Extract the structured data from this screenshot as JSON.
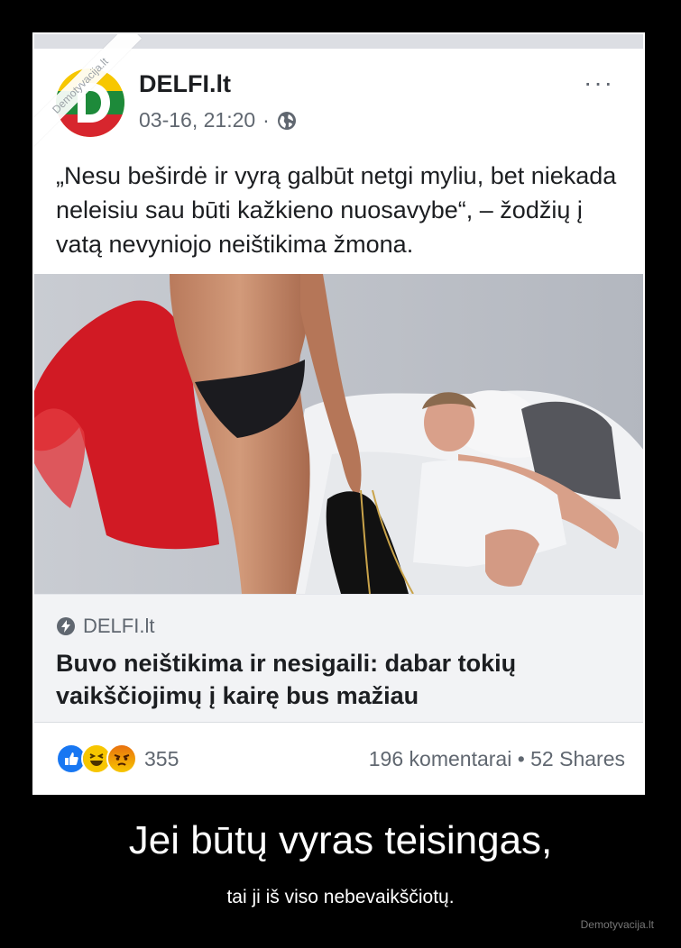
{
  "post": {
    "page_name": "DELFI.lt",
    "timestamp": "03-16, 21:20",
    "separator": "·",
    "more": "···",
    "text": "„Nesu beširdė ir vyrą galbūt netgi myliu, bet niekada neleisiu sau būti kažkieno nuosavybe“, – žodžių į vatą nevyniojo neištikima žmona."
  },
  "ribbon": "Demotyvacija.lt",
  "icons": {
    "avatar": "delfi-logo-icon",
    "privacy": "globe-icon",
    "source": "lightning-icon",
    "reactions": [
      "like-icon",
      "haha-icon",
      "angry-icon"
    ]
  },
  "link": {
    "source": "DELFI.lt",
    "title": "Buvo neištikima ir nesigaili: dabar tokių vaikščiojimų į kairę bus mažiau"
  },
  "footer": {
    "reaction_count": "355",
    "stats": "196 komentarai • 52 Shares"
  },
  "colors": {
    "logo_yellow": "#f7c700",
    "logo_green": "#1d8a3a",
    "logo_red": "#d7262e",
    "like_blue": "#1877f2",
    "haha_yellow": "#f7c600",
    "angry_red": "#e9710f"
  },
  "caption": {
    "title": "Jei būtų vyras teisingas,",
    "subtitle": "tai ji iš viso nebevaikščiotų.",
    "watermark": "Demotyvacija.lt"
  }
}
